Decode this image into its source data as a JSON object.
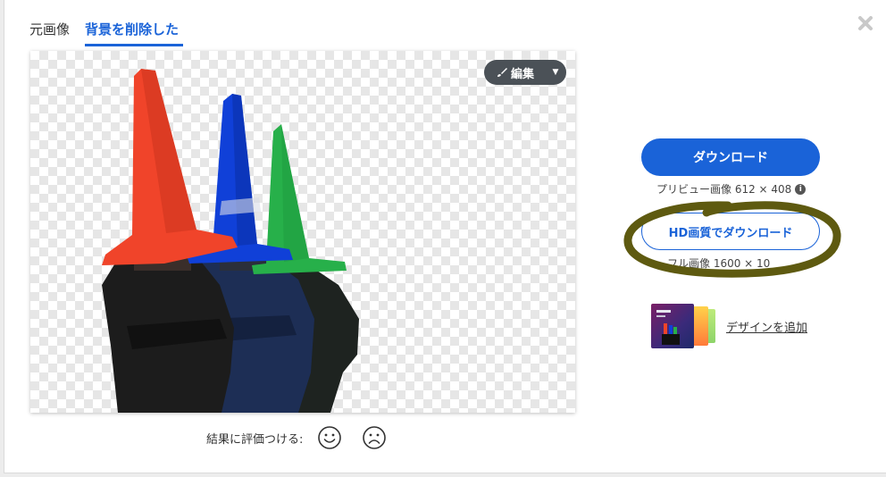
{
  "tabs": [
    {
      "label": "元画像",
      "active": false
    },
    {
      "label": "背景を削除した",
      "active": true
    }
  ],
  "editor": {
    "edit_label": "編集"
  },
  "rating": {
    "label": "結果に評価つける:"
  },
  "download": {
    "primary_label": "ダウンロード",
    "preview_info": "プリビュー画像 612 × 408",
    "hd_label": "HD画質でダウンロード",
    "full_info": "フル画像 1600 × 10"
  },
  "design": {
    "link_label": "デザインを追加"
  },
  "colors": {
    "accent": "#1a63d8",
    "annotation": "#5e5a10",
    "cone_red": "#f0442a",
    "cone_blue": "#1040d8",
    "cone_green": "#27b04a"
  }
}
